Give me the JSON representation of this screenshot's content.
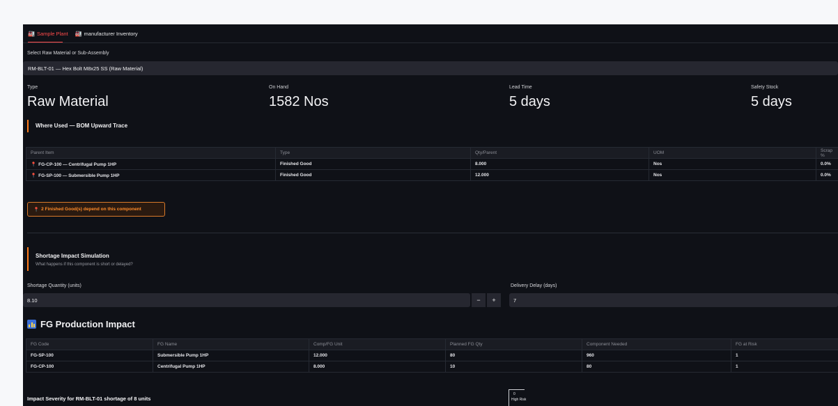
{
  "tabs": [
    {
      "label": "Sample Plant",
      "active": true
    },
    {
      "label": "manufacturer Inventory",
      "active": false
    }
  ],
  "select": {
    "label": "Select Raw Material or Sub-Assembly",
    "value": "RM-BLT-01 — Hex Bolt M8x25 SS (Raw Material)"
  },
  "metrics": [
    {
      "label": "Type",
      "value": "Raw Material"
    },
    {
      "label": "On Hand",
      "value": "1582 Nos"
    },
    {
      "label": "Lead Time",
      "value": "5 days"
    },
    {
      "label": "Safety Stock",
      "value": "5 days"
    }
  ],
  "where_used": {
    "title": "Where Used — BOM Upward Trace",
    "columns": [
      "Parent Item",
      "Type",
      "Qty/Parent",
      "UOM",
      "Scrap %"
    ],
    "rows": [
      [
        "FG-CP-100 — Centrifugal Pump 1HP",
        "Finished Good",
        "8.000",
        "Nos",
        "0.0%"
      ],
      [
        "FG-SP-100 — Submersible Pump 1HP",
        "Finished Good",
        "12.000",
        "Nos",
        "0.0%"
      ]
    ]
  },
  "dependency_badge": "2 Finished Good(s) depend on this component",
  "shortage": {
    "title": "Shortage Impact Simulation",
    "subtitle": "What happens if this component is short or delayed?",
    "qty_label": "Shortage Quantity (units)",
    "qty_value": "8.10",
    "delay_label": "Delivery Delay (days)",
    "delay_value": "7",
    "minus": "−",
    "plus": "+"
  },
  "fg_impact": {
    "title": "FG Production Impact",
    "columns": [
      "FG Code",
      "FG Name",
      "Comp/FG Unit",
      "Planned FG Qty",
      "Component Needed",
      "FG at Risk"
    ],
    "rows": [
      [
        "FG-SP-100",
        "Submersible Pump 1HP",
        "12.000",
        "80",
        "960",
        "1"
      ],
      [
        "FG-CP-100",
        "Centrifugal Pump 1HP",
        "8.000",
        "10",
        "80",
        "1"
      ]
    ]
  },
  "severity": {
    "title": "Impact Severity for RM-BLT-01 shortage of 8 units",
    "tick": "0",
    "risk_label": "High Risk"
  },
  "icons": {
    "tab": "factory-icon",
    "row": "pushpin-icon",
    "chart": "bar-chart-icon"
  },
  "colors": {
    "accent": "#ff4b4b",
    "warning": "#ff8c2a",
    "background": "#0f1117"
  }
}
